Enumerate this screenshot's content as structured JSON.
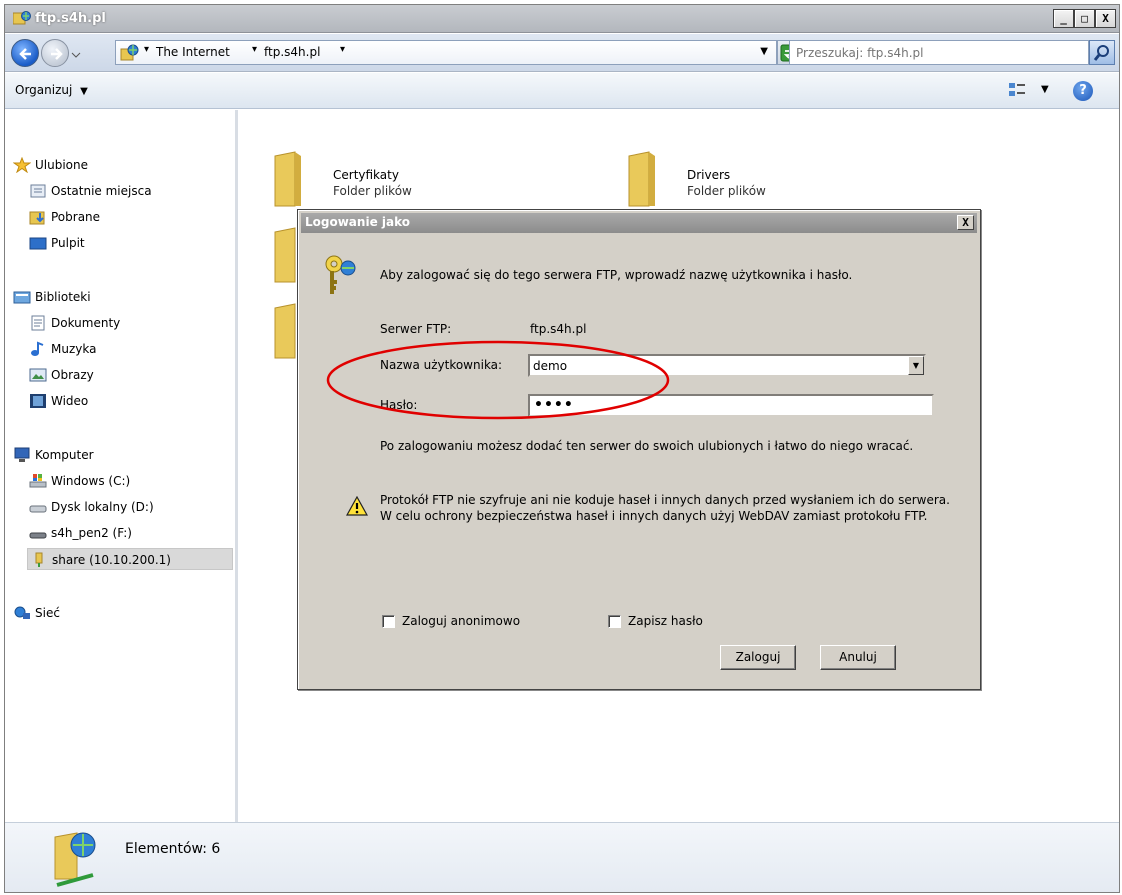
{
  "window": {
    "title": "ftp.s4h.pl",
    "minimize": "_",
    "maximize": "□",
    "close": "X"
  },
  "address_bar": {
    "crumbs": [
      "The Internet",
      "ftp.s4h.pl"
    ],
    "search_placeholder": "Przeszukaj: ftp.s4h.pl"
  },
  "command_bar": {
    "organize_label": "Organizuj",
    "help_label": "?"
  },
  "nav_pane": {
    "favorites": {
      "label": "Ulubione",
      "items": [
        "Ostatnie miejsca",
        "Pobrane",
        "Pulpit"
      ]
    },
    "libraries": {
      "label": "Biblioteki",
      "items": [
        "Dokumenty",
        "Muzyka",
        "Obrazy",
        "Wideo"
      ]
    },
    "computer": {
      "label": "Komputer",
      "items": [
        "Windows (C:)",
        "Dysk lokalny (D:)",
        "s4h_pen2 (F:)",
        "share (10.10.200.1)"
      ]
    },
    "network": {
      "label": "Sieć"
    }
  },
  "content": {
    "folders": [
      {
        "name": "Certyfikaty",
        "type": "Folder plików"
      },
      {
        "name": "Drivers",
        "type": "Folder plików"
      }
    ]
  },
  "status_bar": {
    "text": "Elementów: 6"
  },
  "dialog": {
    "title": "Logowanie jako",
    "close": "X",
    "intro": "Aby zalogować się do tego serwera FTP, wprowadź nazwę użytkownika i hasło.",
    "server_label": "Serwer FTP:",
    "server_value": "ftp.s4h.pl",
    "username_label": "Nazwa użytkownika:",
    "username_value": "demo",
    "password_label": "Hasło:",
    "password_value": "••••",
    "info": "Po zalogowaniu możesz dodać ten serwer do swoich ulubionych i łatwo do niego wracać.",
    "warning": "Protokół FTP nie szyfruje ani nie koduje haseł i innych danych przed wysłaniem ich do serwera. W celu ochrony bezpieczeństwa haseł i innych danych użyj WebDAV zamiast protokołu FTP.",
    "anonymous_label": "Zaloguj anonimowo",
    "save_password_label": "Zapisz hasło",
    "login_button": "Zaloguj",
    "cancel_button": "Anuluj",
    "highlight_color": "#e00000"
  }
}
